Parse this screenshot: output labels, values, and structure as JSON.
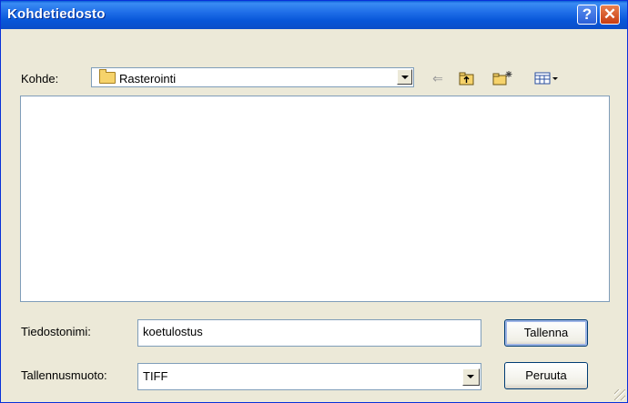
{
  "dialog": {
    "title": "Kohdetiedosto",
    "help_glyph": "?",
    "close_glyph": "✕"
  },
  "location": {
    "label": "Kohde:",
    "selected": "Rasterointi"
  },
  "toolbar": {
    "back_glyph": "⇐",
    "icons": [
      "back-icon",
      "up-folder-icon",
      "new-folder-icon",
      "view-menu-icon"
    ]
  },
  "filename": {
    "label": "Tiedostonimi:",
    "value": "koetulostus"
  },
  "filetype": {
    "label": "Tallennusmuoto:",
    "selected": "TIFF"
  },
  "buttons": {
    "save": "Tallenna",
    "cancel": "Peruuta"
  }
}
